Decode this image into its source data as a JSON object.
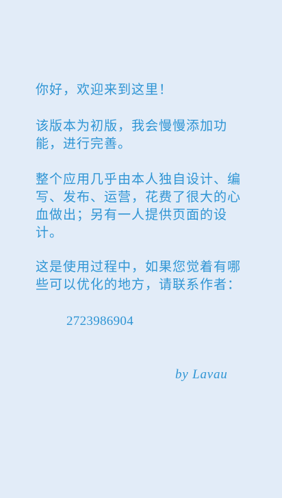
{
  "about": {
    "greeting": "你好，欢迎来到这里！",
    "version_note": "该版本为初版，我会慢慢添加功能，进行完善。",
    "credits": "整个应用几乎由本人独自设计、编写、发布、运营，花费了很大的心血做出；另有一人提供页面的设计。",
    "contact_prompt": "这是使用过程中，如果您觉着有哪些可以优化的地方，请联系作者：",
    "contact_number": "2723986904",
    "signature": "by Lavau"
  },
  "colors": {
    "background": "#e2ecf8",
    "text": "#2f95d4"
  }
}
